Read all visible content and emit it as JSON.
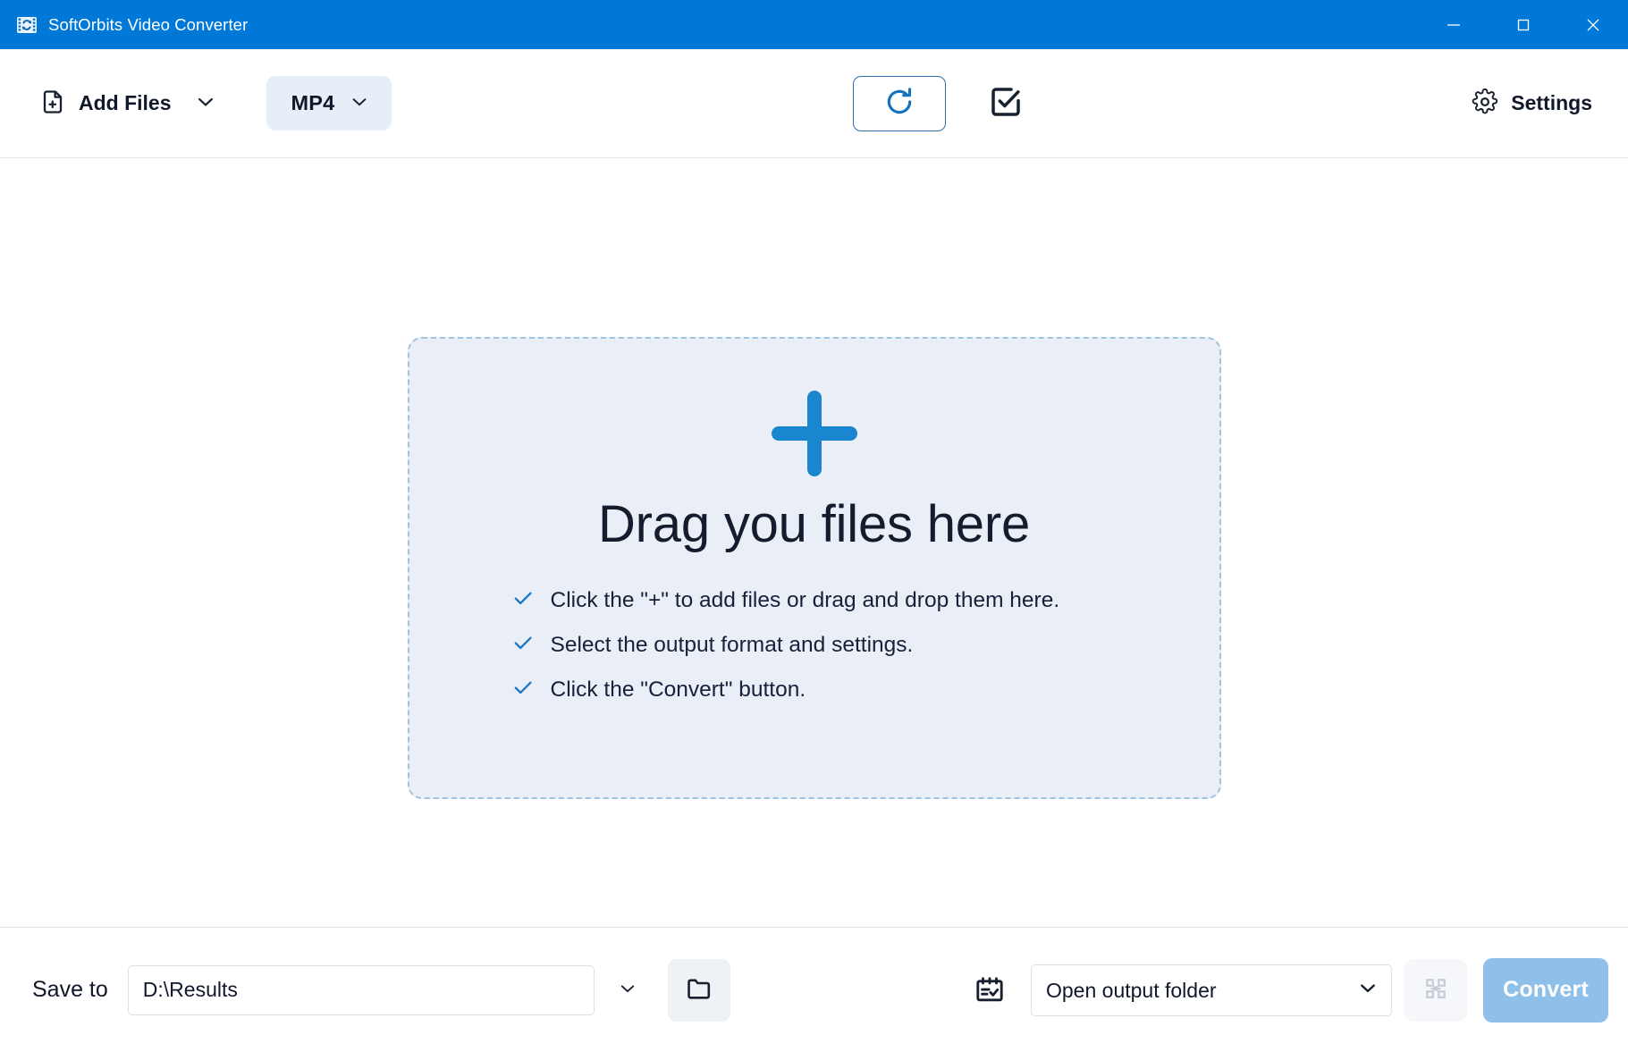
{
  "window": {
    "title": "SoftOrbits Video Converter",
    "app_icon": "film-convert-icon",
    "controls": {
      "minimize": "minimize-icon",
      "maximize": "maximize-icon",
      "close": "close-icon"
    },
    "titlebar_color": "#0078d7"
  },
  "toolbar": {
    "add_files_label": "Add Files",
    "add_files_icon": "file-plus-icon",
    "add_files_caret_icon": "chevron-down-icon",
    "format_label": "MP4",
    "format_caret_icon": "chevron-down-icon",
    "refresh_icon": "refresh-rotate-icon",
    "checkbox_icon": "checkbox-check-icon",
    "settings_label": "Settings",
    "settings_icon": "gear-icon",
    "accent_color": "#1573bd"
  },
  "dropzone": {
    "plus_icon": "plus-icon",
    "title": "Drag you files here",
    "background_color": "#eaeff7",
    "border_color": "#9ec6e0",
    "items": [
      {
        "check_icon": "check-icon",
        "text": "Click the \"+\" to add files or drag and drop them here."
      },
      {
        "check_icon": "check-icon",
        "text": "Select the output format and settings."
      },
      {
        "check_icon": "check-icon",
        "text": "Click the \"Convert\" button."
      }
    ]
  },
  "bottombar": {
    "save_to_label": "Save to",
    "path_value": "D:\\Results",
    "path_placeholder": "D:\\Results",
    "path_caret_icon": "chevron-down-icon",
    "browse_icon": "folder-icon",
    "schedule_icon": "calendar-check-icon",
    "output_action_value": "Open output folder",
    "output_action_options": [
      "Open output folder"
    ],
    "output_caret_icon": "chevron-down-icon",
    "merge_icon": "merge-files-icon",
    "convert_label": "Convert",
    "convert_color": "#8fc0ea"
  }
}
